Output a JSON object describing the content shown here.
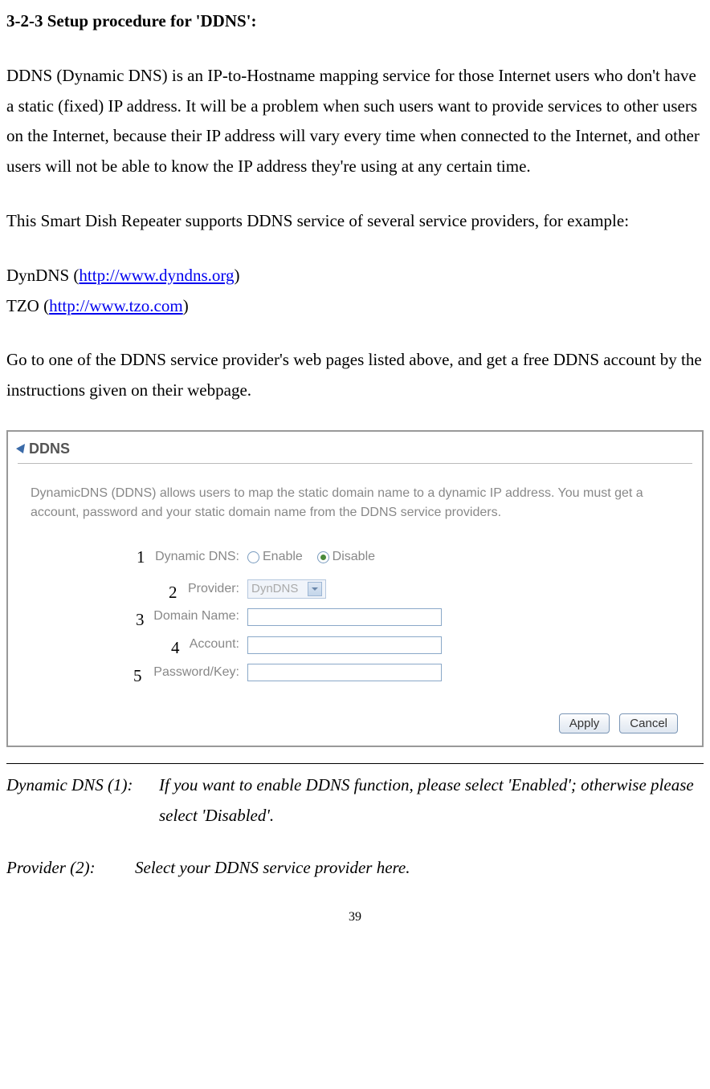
{
  "heading": "3-2-3 Setup procedure for 'DDNS':",
  "para1": "DDNS (Dynamic DNS) is an IP-to-Hostname mapping service for those Internet users who don't have a static (fixed) IP address. It will be a problem when such users want to provide services to other users on the Internet, because their IP address will vary every time when connected to the Internet, and other users will not be able to know the IP address they're using at any certain time.",
  "para2": "This Smart Dish Repeater supports DDNS service of several service providers, for example:",
  "link1_pre": "DynDNS (",
  "link1": "http://www.dyndns.org",
  "link1_post": ")",
  "link2_pre": "TZO (",
  "link2": "http://www.tzo.com",
  "link2_post": ")",
  "para3": "Go to one of the DDNS service provider's web pages listed above, and get a free DDNS account by the instructions given on their webpage.",
  "panel": {
    "title": "DDNS",
    "desc": "DynamicDNS (DDNS) allows users to map the static domain name to a dynamic IP address. You must get a account, password and your static domain name from the DDNS service providers.",
    "rows": {
      "r1": {
        "num": "1",
        "label": "Dynamic DNS:",
        "enable": "Enable",
        "disable": "Disable"
      },
      "r2": {
        "num": "2",
        "label": "Provider:",
        "selected": "DynDNS"
      },
      "r3": {
        "num": "3",
        "label": "Domain Name:"
      },
      "r4": {
        "num": "4",
        "label": "Account:"
      },
      "r5": {
        "num": "5",
        "label": "Password/Key:"
      }
    },
    "apply": "Apply",
    "cancel": "Cancel"
  },
  "desc1_label": "Dynamic DNS (1):",
  "desc1_text": "If you want to enable DDNS function, please select 'Enabled'; otherwise please select 'Disabled'.",
  "desc2_label": "Provider (2):",
  "desc2_text": "Select your DDNS service provider here.",
  "page_num": "39"
}
